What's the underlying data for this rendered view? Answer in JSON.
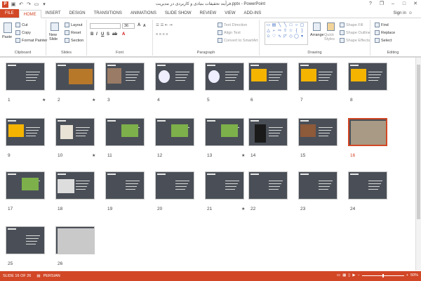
{
  "title": "فرآیند تحقیقات بنیادی و کاربردی در مدیریت.pptx - PowerPoint",
  "qat": {
    "app_icon": "P",
    "save_icon": "save-icon",
    "undo_icon": "undo-icon",
    "redo_icon": "redo-icon"
  },
  "window": {
    "help": "?",
    "restore": "❐",
    "minimize": "–",
    "maximize": "□",
    "close": "✕"
  },
  "tabs": [
    "FILE",
    "HOME",
    "INSERT",
    "DESIGN",
    "TRANSITIONS",
    "ANIMATIONS",
    "SLIDE SHOW",
    "REVIEW",
    "VIEW",
    "ADD-INS"
  ],
  "active_tab": "HOME",
  "sign_in": "Sign in",
  "ribbon": {
    "clipboard": {
      "label": "Clipboard",
      "paste": "Paste",
      "cut": "Cut",
      "copy": "Copy",
      "format_painter": "Format Painter"
    },
    "slides": {
      "label": "Slides",
      "new_slide": "New Slide",
      "layout": "Layout",
      "reset": "Reset",
      "section": "Section"
    },
    "font": {
      "label": "Font",
      "size": "36"
    },
    "paragraph": {
      "label": "Paragraph",
      "text_direction": "Text Direction",
      "align_text": "Align Text",
      "convert": "Convert to SmartArt"
    },
    "drawing": {
      "label": "Drawing",
      "arrange": "Arrange",
      "quick_styles": "Quick Styles",
      "shape_fill": "Shape Fill",
      "shape_outline": "Shape Outline",
      "shape_effects": "Shape Effects"
    },
    "editing": {
      "label": "Editing",
      "find": "Find",
      "replace": "Replace",
      "select": "Select"
    }
  },
  "slides": [
    {
      "n": "1",
      "star": true,
      "pic": "none"
    },
    {
      "n": "2",
      "star": true,
      "pic": "tiles"
    },
    {
      "n": "3",
      "star": false,
      "pic": "face"
    },
    {
      "n": "4",
      "star": false,
      "pic": "target"
    },
    {
      "n": "5",
      "star": false,
      "pic": "target"
    },
    {
      "n": "6",
      "star": false,
      "pic": "puzzle"
    },
    {
      "n": "7",
      "star": false,
      "pic": "puzzle"
    },
    {
      "n": "8",
      "star": false,
      "pic": "puzzle"
    },
    {
      "n": "9",
      "star": false,
      "pic": "puzzle"
    },
    {
      "n": "10",
      "star": true,
      "pic": "people"
    },
    {
      "n": "11",
      "star": false,
      "pic": "grass"
    },
    {
      "n": "12",
      "star": false,
      "pic": "grass"
    },
    {
      "n": "13",
      "star": true,
      "pic": "grass"
    },
    {
      "n": "14",
      "star": false,
      "pic": "grad"
    },
    {
      "n": "15",
      "star": false,
      "pic": "books"
    },
    {
      "n": "16",
      "star": false,
      "pic": "room"
    },
    {
      "n": "17",
      "star": false,
      "pic": "grass"
    },
    {
      "n": "18",
      "star": false,
      "pic": "book"
    },
    {
      "n": "19",
      "star": false,
      "pic": "none"
    },
    {
      "n": "20",
      "star": false,
      "pic": "none"
    },
    {
      "n": "21",
      "star": true,
      "pic": "none"
    },
    {
      "n": "22",
      "star": false,
      "pic": "none"
    },
    {
      "n": "23",
      "star": false,
      "pic": "none"
    },
    {
      "n": "24",
      "star": false,
      "pic": "none"
    },
    {
      "n": "25",
      "star": false,
      "pic": "none"
    },
    {
      "n": "26",
      "star": false,
      "pic": "laptop"
    }
  ],
  "selected_slide": "16",
  "status": {
    "slide_info": "SLIDE 16 OF 26",
    "language": "PERSIAN",
    "zoom": "50%",
    "zoom_minus": "−",
    "zoom_plus": "+",
    "zoom_fraction": 0.5
  },
  "colors": {
    "accent": "#d24726"
  }
}
